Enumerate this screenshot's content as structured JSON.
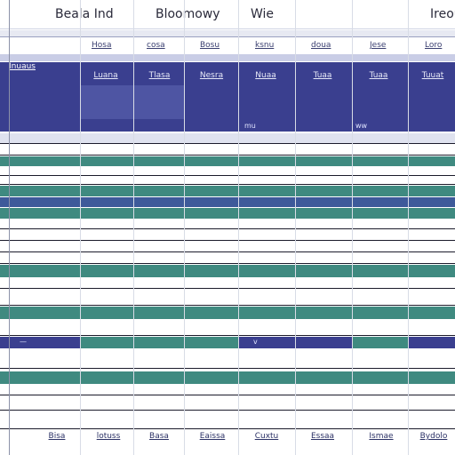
{
  "headers": [
    "Beala Ind",
    "Bloomowy",
    "Wie",
    "Ireou"
  ],
  "sublabels": [
    "Hosa",
    "cosa",
    "Bosu",
    "ksnu",
    "doua",
    "Jese",
    "Loro"
  ],
  "nav_row": {
    "first_label": "Inuaus",
    "labels": [
      "Luana",
      "Tlasa",
      "Nesra",
      "Nuaa",
      "Tuaa",
      "Tuaa",
      "Tuuat"
    ]
  },
  "notes": {
    "n1": "mu",
    "n2": "ww",
    "n3": "—",
    "n4": "v"
  },
  "footer": [
    "Bisa",
    "lotuss",
    "Basa",
    "Eaissa",
    "Cuxtu",
    "Essaa",
    "Ismae",
    "Bydolo"
  ],
  "colors": {
    "navy": "#3a3f8f",
    "navy_light": "#5a62b0",
    "teal": "#3f8a80",
    "lavender": "#c9cde6",
    "header_bg": "#ffffff",
    "grid": "#1b1b2b"
  }
}
